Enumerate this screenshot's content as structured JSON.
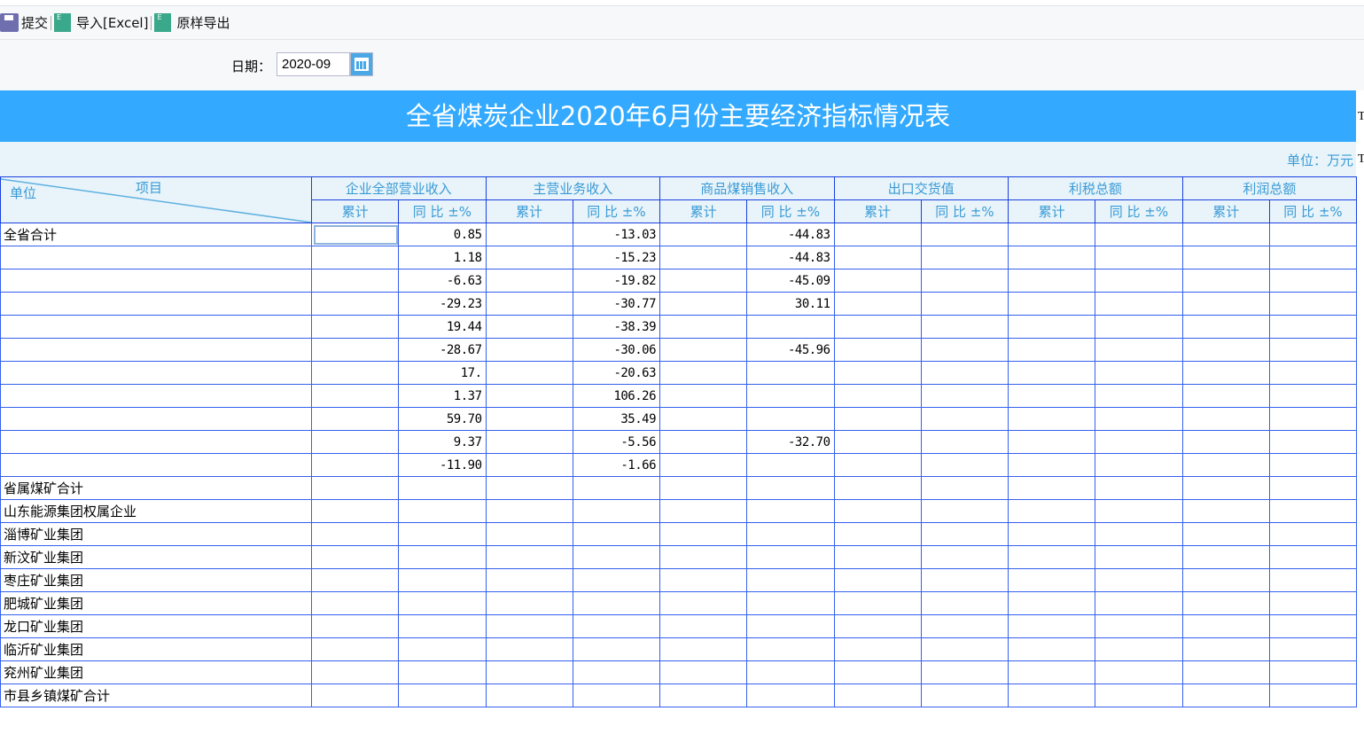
{
  "toolbar": {
    "submit": "提交",
    "import": "导入[Excel]",
    "export": "原样导出"
  },
  "filter": {
    "date_label": "日期：",
    "date_value": "2020-09"
  },
  "title": "全省煤炭企业2020年6月份主要经济指标情况表",
  "unit": "单位：万元",
  "header": {
    "corner_unit": "单位",
    "corner_item": "项目",
    "groups": [
      "企业全部营业收入",
      "主营业务收入",
      "商品煤销售收入",
      "出口交货值",
      "利税总额",
      "利润总额"
    ],
    "sub": [
      "累计",
      "同 比 ±%"
    ]
  },
  "rows": [
    {
      "name": "全省合计",
      "v": [
        "",
        "0.85",
        "",
        "-13.03",
        "",
        "-44.83",
        "",
        "",
        "",
        "",
        "",
        ""
      ]
    },
    {
      "name": "",
      "v": [
        "",
        "1.18",
        "",
        "-15.23",
        "",
        "-44.83",
        "",
        "",
        "",
        "",
        "",
        ""
      ]
    },
    {
      "name": "",
      "v": [
        "",
        "-6.63",
        "",
        "-19.82",
        "",
        "-45.09",
        "",
        "",
        "",
        "",
        "",
        ""
      ]
    },
    {
      "name": "",
      "v": [
        "",
        "-29.23",
        "",
        "-30.77",
        "",
        "30.11",
        "",
        "",
        "",
        "",
        "",
        ""
      ]
    },
    {
      "name": "",
      "v": [
        "",
        "19.44",
        "",
        "-38.39",
        "",
        "",
        "",
        "",
        "",
        "",
        "",
        ""
      ]
    },
    {
      "name": "",
      "v": [
        "",
        "-28.67",
        "",
        "-30.06",
        "",
        "-45.96",
        "",
        "",
        "",
        "",
        "",
        ""
      ]
    },
    {
      "name": "",
      "v": [
        "",
        "17.",
        "",
        "-20.63",
        "",
        "",
        "",
        "",
        "",
        "",
        "",
        ""
      ]
    },
    {
      "name": "",
      "v": [
        "",
        "1.37",
        "",
        "106.26",
        "",
        "",
        "",
        "",
        "",
        "",
        "",
        ""
      ]
    },
    {
      "name": "",
      "v": [
        "",
        "59.70",
        "",
        "35.49",
        "",
        "",
        "",
        "",
        "",
        "",
        "",
        ""
      ]
    },
    {
      "name": "",
      "v": [
        "",
        "9.37",
        "",
        "-5.56",
        "",
        "-32.70",
        "",
        "",
        "",
        "",
        "",
        ""
      ]
    },
    {
      "name": "",
      "v": [
        "",
        "-11.90",
        "",
        "-1.66",
        "",
        "",
        "",
        "",
        "",
        "",
        "",
        ""
      ]
    },
    {
      "name": "省属煤矿合计",
      "v": [
        "",
        "",
        "",
        "",
        "",
        "",
        "",
        "",
        "",
        "",
        "",
        ""
      ]
    },
    {
      "name": "山东能源集团权属企业",
      "v": [
        "",
        "",
        "",
        "",
        "",
        "",
        "",
        "",
        "",
        "",
        "",
        ""
      ]
    },
    {
      "name": "淄博矿业集团",
      "v": [
        "",
        "",
        "",
        "",
        "",
        "",
        "",
        "",
        "",
        "",
        "",
        ""
      ]
    },
    {
      "name": "新汶矿业集团",
      "v": [
        "",
        "",
        "",
        "",
        "",
        "",
        "",
        "",
        "",
        "",
        "",
        ""
      ]
    },
    {
      "name": "枣庄矿业集团",
      "v": [
        "",
        "",
        "",
        "",
        "",
        "",
        "",
        "",
        "",
        "",
        "",
        ""
      ]
    },
    {
      "name": "肥城矿业集团",
      "v": [
        "",
        "",
        "",
        "",
        "",
        "",
        "",
        "",
        "",
        "",
        "",
        ""
      ]
    },
    {
      "name": "龙口矿业集团",
      "v": [
        "",
        "",
        "",
        "",
        "",
        "",
        "",
        "",
        "",
        "",
        "",
        ""
      ]
    },
    {
      "name": "临沂矿业集团",
      "v": [
        "",
        "",
        "",
        "",
        "",
        "",
        "",
        "",
        "",
        "",
        "",
        ""
      ]
    },
    {
      "name": "兖州矿业集团",
      "v": [
        "",
        "",
        "",
        "",
        "",
        "",
        "",
        "",
        "",
        "",
        "",
        ""
      ]
    },
    {
      "name": "市县乡镇煤矿合计",
      "v": [
        "",
        "",
        "",
        "",
        "",
        "",
        "",
        "",
        "",
        "",
        "",
        ""
      ]
    }
  ],
  "colors": {
    "title_bg": "#33aaff",
    "header_bg": "#e8f4fa",
    "header_text": "#3a9ad6",
    "grid": "#3560f0"
  }
}
